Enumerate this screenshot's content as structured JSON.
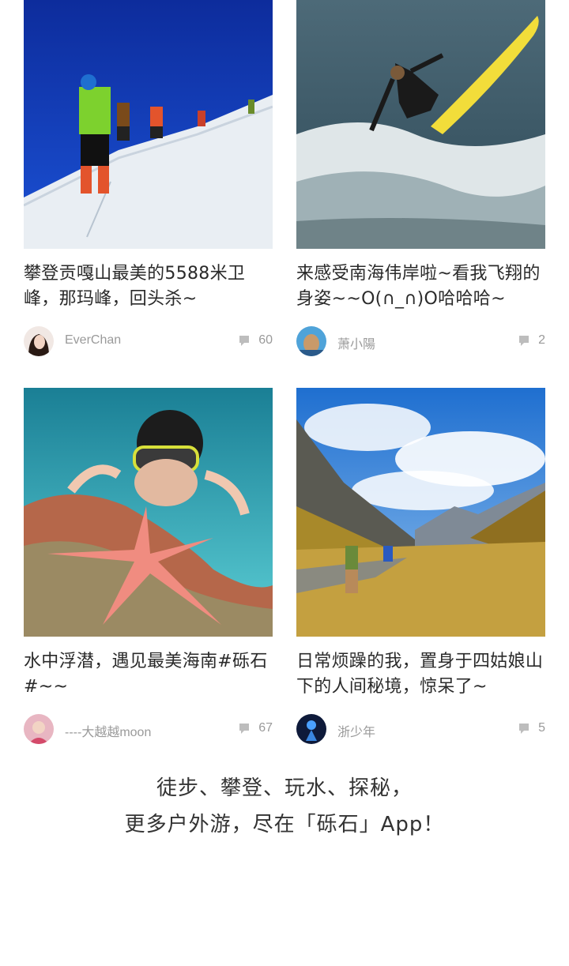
{
  "cards": [
    {
      "title": "攀登贡嘎山最美的5588米卫峰，那玛峰，回头杀~",
      "author": "EverChan",
      "comments": "60",
      "image_icon": "mountaineering-photo"
    },
    {
      "title": "来感受南海伟岸啦~看我飞翔的身姿~~O(∩_∩)O哈哈哈~",
      "author": "萧小陽",
      "comments": "2",
      "image_icon": "surfing-photo"
    },
    {
      "title": "水中浮潜，遇见最美海南#砾石#~~",
      "author": "----大越越moon",
      "comments": "67",
      "image_icon": "snorkeling-photo"
    },
    {
      "title": "日常烦躁的我，置身于四姑娘山下的人间秘境，惊呆了~",
      "author": "浙少年",
      "comments": "5",
      "image_icon": "hiking-valley-photo"
    }
  ],
  "footer": {
    "line1": "徒步、攀登、玩水、探秘，",
    "line2": "更多户外游，尽在「砾石」App！"
  },
  "colors": {
    "text": "#2a2a2a",
    "meta": "#9a9a9a"
  }
}
